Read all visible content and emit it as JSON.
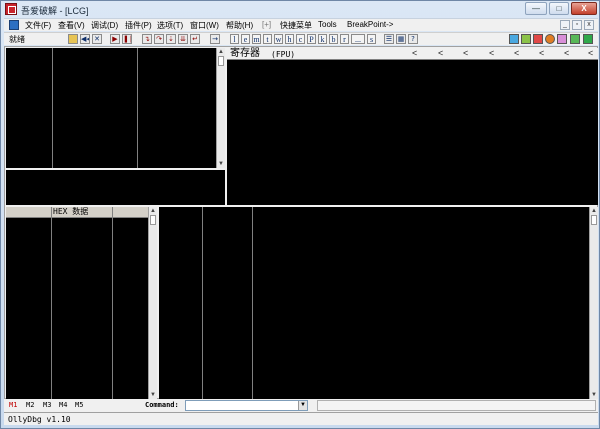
{
  "window": {
    "title": "吾爱破解 - [LCG]",
    "min": "—",
    "max": "□",
    "close": "X"
  },
  "menubar": {
    "items": [
      "文件(F)",
      "查看(V)",
      "调试(D)",
      "插件(P)",
      "选项(T)",
      "窗口(W)",
      "帮助(H)",
      "[+]",
      "快捷菜单",
      "Tools",
      "BreakPoint->"
    ],
    "mdi_min": "_",
    "mdi_restore": "▫",
    "mdi_close": "x"
  },
  "toolbar": {
    "status": "就绪",
    "letters": [
      "l",
      "e",
      "m",
      "t",
      "w",
      "h",
      "c",
      "P",
      "k",
      "b",
      "r",
      "...",
      "s"
    ],
    "help": "?"
  },
  "registers": {
    "label": "寄存器",
    "mode": "(FPU)",
    "arrow": "<"
  },
  "dump": {
    "header": "HEX 数据"
  },
  "bottom": {
    "tabs": [
      "M1",
      "M2",
      "M3",
      "M4",
      "M5"
    ],
    "command_label": "Command:",
    "command_value": "",
    "dropdown": "▼"
  },
  "status": {
    "version": "OllyDbg v1.10"
  },
  "colors": {
    "pane_bg": "#000000",
    "chrome": "#f0f0f0",
    "active_tab": "#c00000",
    "close_button": "#c3402b"
  }
}
